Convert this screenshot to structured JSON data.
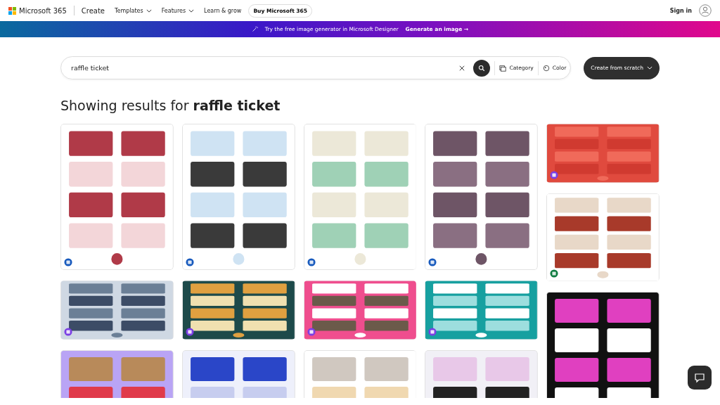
{
  "header": {
    "brand": "Microsoft 365",
    "section": "Create",
    "nav": [
      {
        "label": "Templates",
        "dropdown": true
      },
      {
        "label": "Features",
        "dropdown": true
      },
      {
        "label": "Learn & grow",
        "dropdown": false
      }
    ],
    "buy_button": "Buy Microsoft 365",
    "sign_in": "Sign in"
  },
  "banner": {
    "text": "Try the free image generator in Microsoft Designer",
    "link": "Generate an image →"
  },
  "search": {
    "value": "raffle ticket",
    "filters": [
      "Category",
      "Color"
    ],
    "create_button": "Create from scratch"
  },
  "heading": "Showing results for **raffle ticket**"
}
